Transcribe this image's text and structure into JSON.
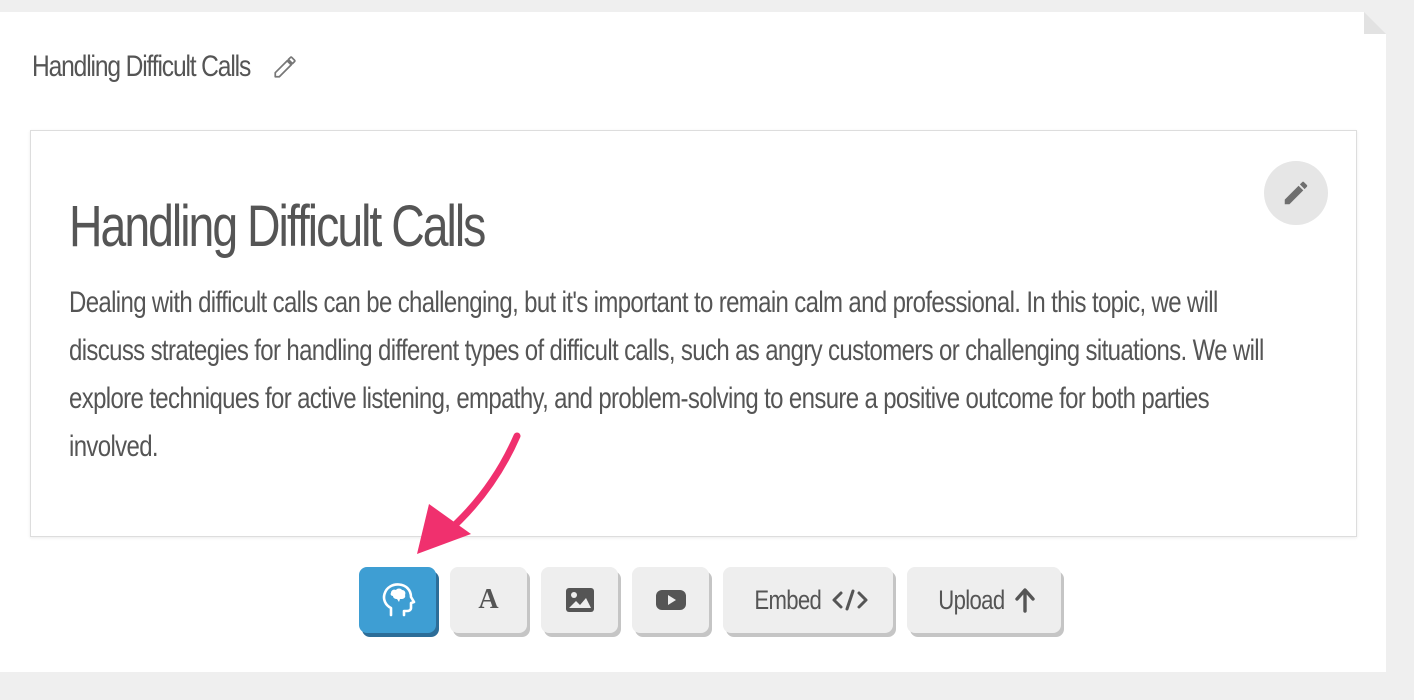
{
  "topic": {
    "title": "Handling Difficult Calls",
    "edit_icon": "pencil-icon"
  },
  "content": {
    "heading": "Handling Difficult Calls",
    "body": "Dealing with difficult calls can be challenging, but it's important to remain calm and professional. In this topic, we will discuss strategies for handling different types of difficult calls, such as angry customers or challenging situations. We will explore techniques for active listening, empathy, and problem-solving to ensure a positive outcome for both parties involved.",
    "edit_icon": "pencil-icon"
  },
  "toolbar": {
    "buttons": [
      {
        "icon": "brain-head-icon",
        "active": true
      },
      {
        "icon": "font-icon",
        "glyph": "A"
      },
      {
        "icon": "image-icon"
      },
      {
        "icon": "video-icon"
      },
      {
        "label": "Embed",
        "icon": "code-icon"
      },
      {
        "label": "Upload",
        "icon": "arrow-up-icon"
      }
    ]
  },
  "colors": {
    "accent": "#3e9ed3",
    "annotation_arrow": "#f0306e",
    "text": "#555555",
    "button_bg": "#eeeeee"
  }
}
